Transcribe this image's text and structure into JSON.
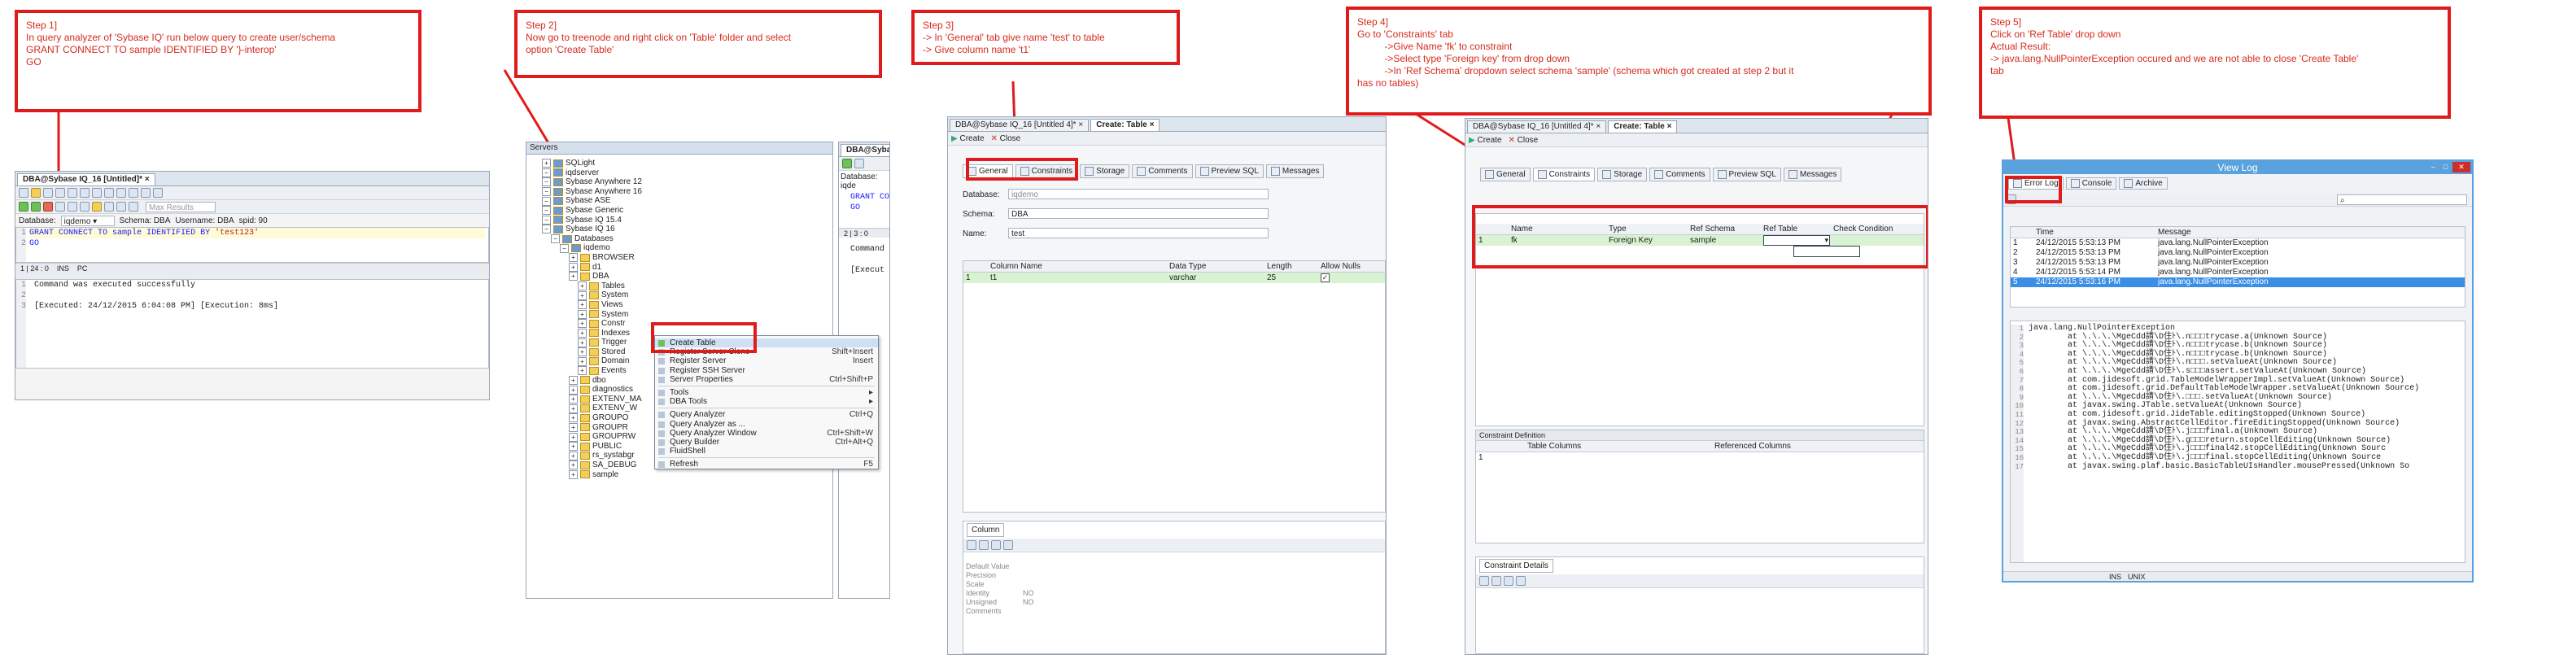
{
  "steps": {
    "s1": [
      "Step 1]",
      "In query analyzer of 'Sybase IQ' run below query to create user/schema",
      "",
      "GRANT CONNECT TO sample IDENTIFIED BY '}-interop'",
      "GO"
    ],
    "s2": [
      "Step 2]",
      "Now go to treenode and right click on 'Table' folder and select",
      "option 'Create Table'"
    ],
    "s3": [
      "Step 3]",
      "-> In 'General' tab give name 'test' to table",
      "-> Give column name 't1'"
    ],
    "s4": [
      "Step 4]",
      "Go to 'Constraints' tab",
      "          ->Give Name 'fk' to constraint",
      "          ->Select type 'Foreign key' from drop down",
      "          ->In 'Ref Schema' dropdown select schema 'sample' (schema which got created at step 2 but it",
      "has no tables)"
    ],
    "s5": [
      "Step 5]",
      "Click on 'Ref Table' drop down",
      "",
      "Actual Result:",
      "-> java.lang.NullPointerException occured and we are not able to close 'Create Table'",
      "tab"
    ]
  },
  "qa": {
    "tab": "DBA@Sybase IQ_16 [Untitled]*",
    "max_results": "Max Results",
    "database_label": "Database:",
    "database_value": "iqdemo",
    "schema": "Schema: DBA",
    "username": "Username: DBA",
    "spid": "spid: 90",
    "line1_kw1": "GRANT CONNECT TO",
    "line1_user": "sample",
    "line1_kw2": "IDENTIFIED BY",
    "line1_str": "'test123'",
    "line2": "GO",
    "status_pos": "1 | 24 : 0",
    "status_ins": "INS",
    "status_pc": "PC",
    "out1": "Command was executed successfully",
    "out2": "[Executed: 24/12/2015 6:04:08 PM] [Execution: 8ms]",
    "gutter": [
      "1",
      "2"
    ],
    "out_gutter": [
      "1",
      "2",
      "3"
    ]
  },
  "tree": {
    "header": "Servers",
    "nodes": [
      {
        "t": "SQLight",
        "lvl": 1
      },
      {
        "t": "iqdserver",
        "lvl": 1
      },
      {
        "t": "Sybase Anywhere 12",
        "lvl": 1
      },
      {
        "t": "Sybase Anywhere 16",
        "lvl": 1
      },
      {
        "t": "Sybase ASE",
        "lvl": 1
      },
      {
        "t": "Sybase Generic",
        "lvl": 1
      },
      {
        "t": "Sybase IQ 15.4",
        "lvl": 1
      },
      {
        "t": "Sybase IQ 16",
        "lvl": 1
      },
      {
        "t": "Databases",
        "lvl": 2
      },
      {
        "t": "iqdemo",
        "lvl": 3
      },
      {
        "t": "BROWSER",
        "lvl": 4
      },
      {
        "t": "d1",
        "lvl": 4
      },
      {
        "t": "DBA",
        "lvl": 4
      },
      {
        "t": "Tables",
        "lvl": 5
      },
      {
        "t": "System",
        "lvl": 5
      },
      {
        "t": "Views",
        "lvl": 5
      },
      {
        "t": "System",
        "lvl": 5
      },
      {
        "t": "Constr",
        "lvl": 5
      },
      {
        "t": "Indexes",
        "lvl": 5
      },
      {
        "t": "Trigger",
        "lvl": 5
      },
      {
        "t": "Stored",
        "lvl": 5
      },
      {
        "t": "Domain",
        "lvl": 5
      },
      {
        "t": "Events",
        "lvl": 5
      },
      {
        "t": "dbo",
        "lvl": 4
      },
      {
        "t": "diagnostics",
        "lvl": 4
      },
      {
        "t": "EXTENV_MA",
        "lvl": 4
      },
      {
        "t": "EXTENV_W",
        "lvl": 4
      },
      {
        "t": "GROUPO",
        "lvl": 4
      },
      {
        "t": "GROUPR",
        "lvl": 4
      },
      {
        "t": "GROUPRW",
        "lvl": 4
      },
      {
        "t": "PUBLIC",
        "lvl": 4
      },
      {
        "t": "rs_systabgr",
        "lvl": 4
      },
      {
        "t": "SA_DEBUG",
        "lvl": 4
      },
      {
        "t": "sample",
        "lvl": 4
      }
    ]
  },
  "menu": [
    {
      "label": "Create Table",
      "acc": "",
      "hl": true
    },
    {
      "label": "Register Server Clone",
      "acc": "Shift+Insert"
    },
    {
      "label": "Register Server",
      "acc": "Insert"
    },
    {
      "label": "Register SSH Server",
      "acc": ""
    },
    {
      "label": "Server Properties",
      "acc": "Ctrl+Shift+P"
    },
    {
      "sep": true
    },
    {
      "label": "Tools",
      "acc": "▸"
    },
    {
      "label": "DBA Tools",
      "acc": "▸"
    },
    {
      "sep": true
    },
    {
      "label": "Query Analyzer",
      "acc": "Ctrl+Q"
    },
    {
      "label": "Query Analyzer as ...",
      "acc": ""
    },
    {
      "label": "Query Analyzer Window",
      "acc": "Ctrl+Shift+W"
    },
    {
      "label": "Query Builder",
      "acc": "Ctrl+Alt+Q"
    },
    {
      "label": "FluidShell",
      "acc": ""
    },
    {
      "sep": true
    },
    {
      "label": "Refresh",
      "acc": "F5"
    }
  ],
  "qa2": {
    "tab": "DBA@Sybas",
    "database": "Database:",
    "dbval": "iqde",
    "l1": "GRANT CO",
    "l2": "GO",
    "pos": "2 | 3 : 0",
    "out": "Command",
    "exec": "[Execut"
  },
  "ct3": {
    "tab1": "DBA@Sybase IQ_16 [Untitled 4]*",
    "tab2": "Create: Table",
    "btn_create": "Create",
    "btn_close": "Close",
    "subtabs": [
      "General",
      "Constraints",
      "Storage",
      "Comments",
      "Preview SQL",
      "Messages"
    ],
    "db_label": "Database:",
    "db_val": "iqdemo",
    "schema_label": "Schema:",
    "schema_val": "DBA",
    "name_label": "Name:",
    "name_val": "test",
    "cols": [
      "Column Name",
      "Data Type",
      "Length",
      "Allow Nulls"
    ],
    "row": {
      "num": "1",
      "name": "t1",
      "type": "varchar",
      "len": "25"
    },
    "column_tab": "Column",
    "props": [
      [
        "Default Value",
        ""
      ],
      [
        "Precision",
        ""
      ],
      [
        "Scale",
        ""
      ],
      [
        "Identity",
        "NO"
      ],
      [
        "Unsigned",
        "NO"
      ],
      [
        "Comments",
        ""
      ]
    ]
  },
  "ct4": {
    "tab1": "DBA@Sybase IQ_16 [Untitled 4]*",
    "tab2": "Create: Table",
    "btn_create": "Create",
    "btn_close": "Close",
    "subtabs": [
      "General",
      "Constraints",
      "Storage",
      "Comments",
      "Preview SQL",
      "Messages"
    ],
    "cols": [
      "Name",
      "Type",
      "Ref Schema",
      "Ref Table",
      "Check Condition"
    ],
    "row": {
      "num": "1",
      "name": "fk",
      "type": "Foreign Key",
      "schema": "sample"
    },
    "cdef": "Constraint Definition",
    "cdef_cols": [
      "Table Columns",
      "Referenced Columns"
    ],
    "cdef_row": "1",
    "details": "Constraint Details"
  },
  "vl": {
    "title": "View Log",
    "tabs": [
      "Error Log",
      "Console",
      "Archive"
    ],
    "cols": [
      "Time",
      "Message"
    ],
    "rows": [
      {
        "n": "1",
        "time": "24/12/2015 5:53:13 PM",
        "msg": "java.lang.NullPointerException"
      },
      {
        "n": "2",
        "time": "24/12/2015 5:53:13 PM",
        "msg": "java.lang.NullPointerException"
      },
      {
        "n": "3",
        "time": "24/12/2015 5:53:13 PM",
        "msg": "java.lang.NullPointerException"
      },
      {
        "n": "4",
        "time": "24/12/2015 5:53:14 PM",
        "msg": "java.lang.NullPointerException"
      },
      {
        "n": "5",
        "time": "24/12/2015 5:53:16 PM",
        "msg": "java.lang.NullPointerException"
      }
    ],
    "trace": [
      "java.lang.NullPointerException",
      "        at \\.\\.\\.\\MgeCdd請\\D住ﾄ\\.n□□□trycase.a(Unknown Source)",
      "        at \\.\\.\\.\\MgeCdd請\\D住ﾄ\\.n□□□trycase.b(Unknown Source)",
      "        at \\.\\.\\.\\MgeCdd請\\D住ﾄ\\.n□□□trycase.b(Unknown Source)",
      "        at \\.\\.\\.\\MgeCdd請\\D住ﾄ\\.n□□□.setValueAt(Unknown Source)",
      "        at \\.\\.\\.\\MgeCdd請\\D住ﾄ\\.s□□□assert.setValueAt(Unknown Source)",
      "        at com.jidesoft.grid.TableModelWrapperImpl.setValueAt(Unknown Source)",
      "        at com.jidesoft.grid.DefaultTableModelWrapper.setValueAt(Unknown Source)",
      "        at \\.\\.\\.\\MgeCdd請\\D住ﾄ\\.□□□.setValueAt(Unknown Source)",
      "        at javax.swing.JTable.setValueAt(Unknown Source)",
      "        at com.jidesoft.grid.JideTable.editingStopped(Unknown Source)",
      "        at javax.swing.AbstractCellEditor.fireEditingStopped(Unknown Source)",
      "        at \\.\\.\\.\\MgeCdd請\\D住ﾄ\\.j□□□final.a(Unknown Source)",
      "        at \\.\\.\\.\\MgeCdd請\\D住ﾄ\\.g□□□return.stopCellEditing(Unknown Source)",
      "        at \\.\\.\\.\\MgeCdd請\\D住ﾄ\\.j□□□final42.stopCellEditing(Unknown Sourc",
      "        at \\.\\.\\.\\MgeCdd請\\D住ﾄ\\.j□□□final.stopCellEditing(Unknown Source",
      "        at javax.swing.plaf.basic.BasicTableUIsHandler.mousePressed(Unknown So"
    ],
    "trace_gutter": [
      "1",
      "2",
      "3",
      "4",
      "5",
      "6",
      "7",
      "8",
      "9",
      "10",
      "11",
      "12",
      "13",
      "14",
      "15",
      "16",
      "17"
    ],
    "status_ins": "INS",
    "status_unix": "UNIX"
  }
}
